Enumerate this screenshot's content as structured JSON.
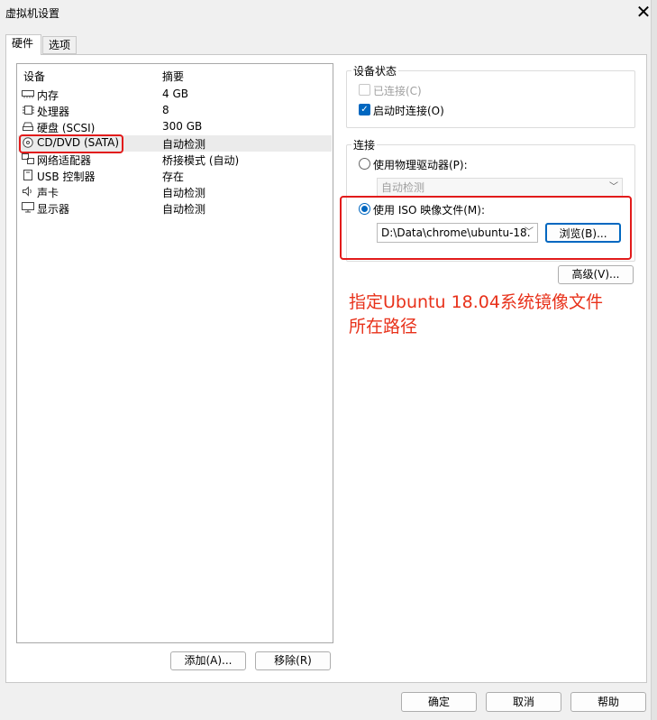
{
  "window": {
    "title": "虚拟机设置",
    "close_glyph": "✕"
  },
  "tabs": [
    {
      "label": "硬件"
    },
    {
      "label": "选项"
    }
  ],
  "device_list": {
    "columns": {
      "device": "设备",
      "summary": "摘要"
    },
    "rows": [
      {
        "icon": "memory-icon",
        "name": "内存",
        "value": "4 GB"
      },
      {
        "icon": "cpu-icon",
        "name": "处理器",
        "value": "8"
      },
      {
        "icon": "hard-disk-icon",
        "name": "硬盘 (SCSI)",
        "value": "300 GB"
      },
      {
        "icon": "cd-dvd-icon",
        "name": "CD/DVD (SATA)",
        "value": "自动检测",
        "selected": true
      },
      {
        "icon": "network-adapter-icon",
        "name": "网络适配器",
        "value": "桥接模式 (自动)"
      },
      {
        "icon": "usb-icon",
        "name": "USB 控制器",
        "value": "存在"
      },
      {
        "icon": "speaker-icon",
        "name": "声卡",
        "value": "自动检测"
      },
      {
        "icon": "monitor-icon",
        "name": "显示器",
        "value": "自动检测"
      }
    ]
  },
  "list_buttons": {
    "add": "添加(A)...",
    "remove": "移除(R)"
  },
  "device_status": {
    "label": "设备状态",
    "connected": {
      "label": "已连接(C)",
      "checked": false,
      "enabled": false
    },
    "connect_on_startup": {
      "label": "启动时连接(O)",
      "checked": true
    }
  },
  "connection": {
    "label": "连接",
    "physical_drive": {
      "label": "使用物理驱动器(P):",
      "selected": false,
      "combo_value": "自动检测"
    },
    "iso_image": {
      "label": "使用 ISO 映像文件(M):",
      "selected": true,
      "path_value": "D:\\Data\\chrome\\ubuntu-18."
    },
    "browse_button": "浏览(B)..."
  },
  "advanced_button": "高级(V)...",
  "annotation": {
    "line1": "指定Ubuntu 18.04系统镜像文件",
    "line2": "所在路径",
    "color": "#e8311a"
  },
  "footer": {
    "ok": "确定",
    "cancel": "取消",
    "help": "帮助"
  },
  "accent_color": "#0067c0",
  "highlight_color": "#e21b1b"
}
